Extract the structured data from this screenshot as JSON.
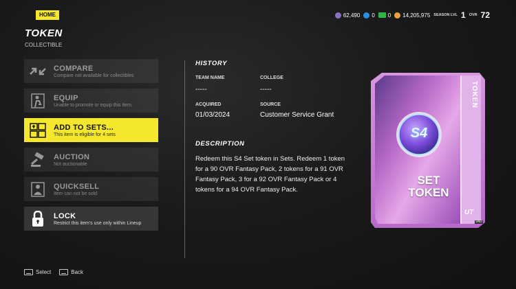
{
  "nav": {
    "home_label": "HOME"
  },
  "header": {
    "title": "TOKEN",
    "subtitle": "COLLECTIBLE"
  },
  "currency": {
    "training": "62,490",
    "credits": "0",
    "cash": "0",
    "coins": "14,205,975",
    "season_label": "SEASON LVL",
    "season_value": "1",
    "ovr_label": "OVR",
    "ovr_value": "72"
  },
  "menu": [
    {
      "label": "COMPARE",
      "desc": "Compare not available for collectibles",
      "icon": "compare-icon",
      "state": "disabled"
    },
    {
      "label": "EQUIP",
      "desc": "Unable to promote or equip this item.",
      "icon": "equip-icon",
      "state": "disabled"
    },
    {
      "label": "ADD TO SETS...",
      "desc": "This item is eligible for 4 sets",
      "icon": "sets-icon",
      "state": "selected"
    },
    {
      "label": "AUCTION",
      "desc": "Not auctionable",
      "icon": "gavel-icon",
      "state": "disabled"
    },
    {
      "label": "QUICKSELL",
      "desc": "Item can not be sold",
      "icon": "quicksell-icon",
      "state": "disabled"
    },
    {
      "label": "LOCK",
      "desc": "Restrict this item's use only within Lineup",
      "icon": "lock-icon",
      "state": "enabled"
    }
  ],
  "history": {
    "heading": "HISTORY",
    "team_name_label": "TEAM NAME",
    "team_name_value": "-----",
    "college_label": "COLLEGE",
    "college_value": "-----",
    "acquired_label": "ACQUIRED",
    "acquired_value": "01/03/2024",
    "source_label": "SOURCE",
    "source_value": "Customer Service Grant"
  },
  "description": {
    "heading": "DESCRIPTION",
    "text": "Redeem this S4 Set token in Sets. Redeem 1 token for a 90 OVR Fantasy Pack, 2 tokens for a 91 OVR Fantasy Pack, 3 for a 92 OVR Fantasy Pack or 4 tokens for a 94 OVR Fantasy Pack."
  },
  "card": {
    "side_label": "TOKEN",
    "badge": "S4",
    "name_line1": "SET",
    "name_line2": "TOKEN",
    "brand": "UT",
    "tiny_tag": "SND"
  },
  "footer": {
    "select_label": "Select",
    "back_label": "Back"
  },
  "colors": {
    "accent": "#f4e72d",
    "card_purple": "#c06ad0",
    "background": "#1a1a1a"
  }
}
